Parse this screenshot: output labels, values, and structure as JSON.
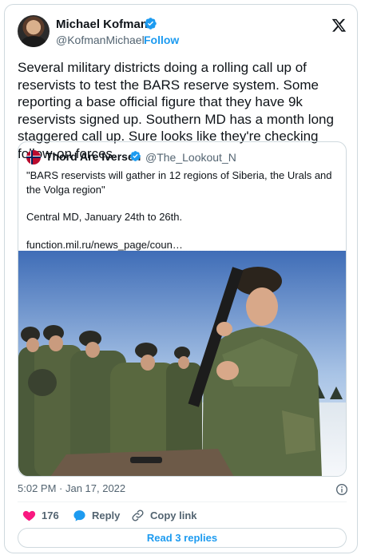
{
  "author": {
    "name": "Michael Kofman",
    "handle": "@KofmanMichael",
    "separator": "·",
    "follow_label": "Follow",
    "verified": true,
    "avatar_icon": "avatar-photo",
    "brand_icon": "x-logo-icon"
  },
  "tweet": {
    "text": "Several military districts doing a rolling call up of reservists to test the BARS reserve system. Some reporting a base official figure that they have 9k reservists signed up. Southern MD has a month long staggered call up. Sure looks like they're checking follow-on forces."
  },
  "quoted": {
    "name": "Thord Are Iversen",
    "handle": "@The_Lookout_N",
    "verified": true,
    "avatar_icon": "norway-flag-avatar",
    "line1": "\"BARS reservists will gather in 12 regions of Siberia, the Urals and the Volga region\"",
    "line2": "Central MD, January 24th to 26th.",
    "line3": "function.mil.ru/news_page/coun…",
    "image_description_icon": "soldiers-photo"
  },
  "meta": {
    "timestamp": "5:02 PM · Jan 17, 2022"
  },
  "actions": {
    "like_count": "176",
    "reply_label": "Reply",
    "copy_label": "Copy link",
    "read_replies_label": "Read 3 replies"
  },
  "colors": {
    "accent": "#1d9bf0",
    "like": "#f91880",
    "text": "#0f1419",
    "muted": "#536471",
    "border": "#cfd9de"
  }
}
